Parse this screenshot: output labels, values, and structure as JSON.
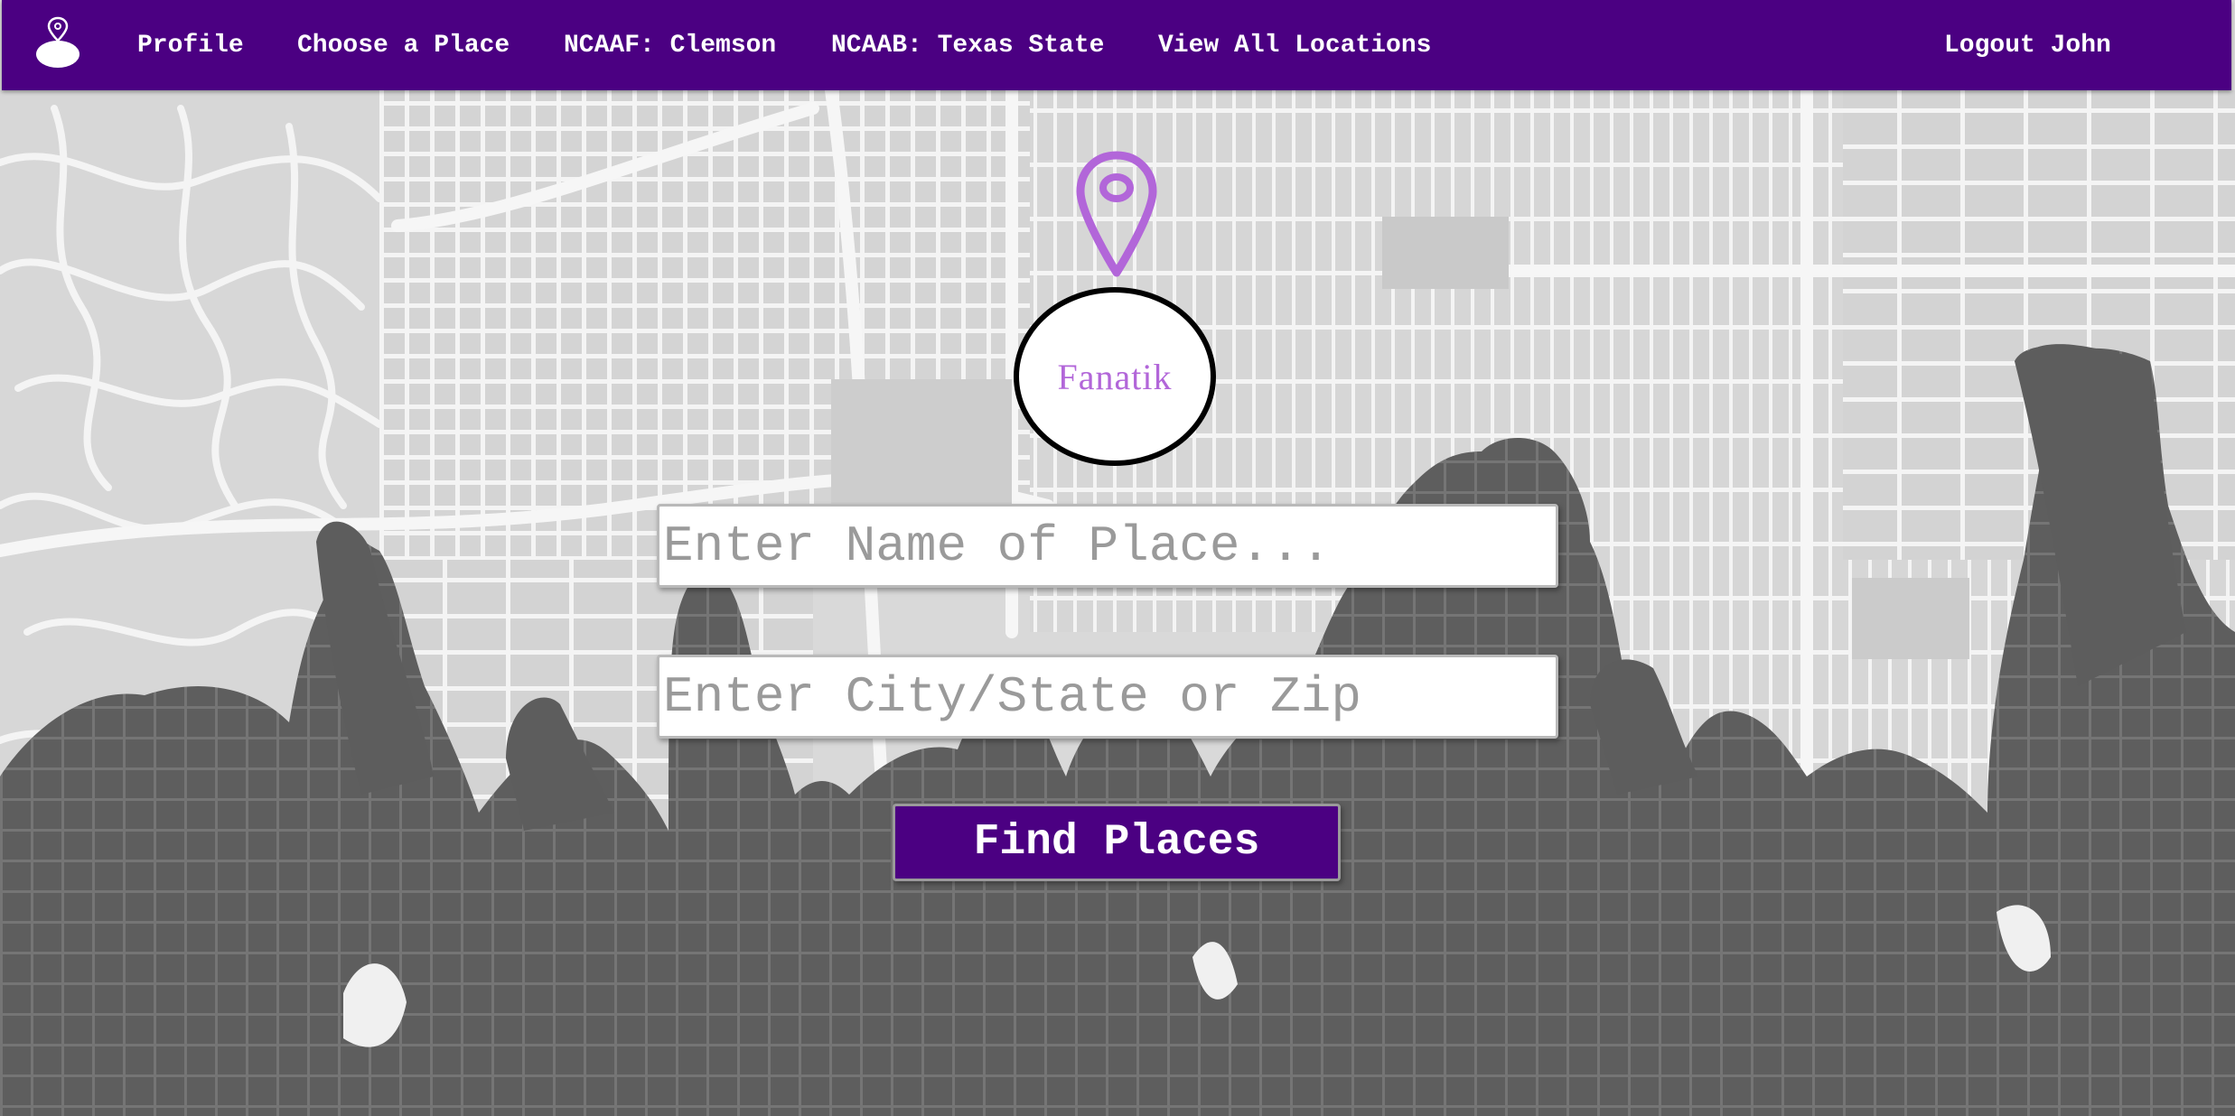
{
  "colors": {
    "brand_purple": "#4b0082",
    "accent_lavender": "#b266d9",
    "map_land": "#d9d9d9",
    "map_roads": "#f4f4f4",
    "crowd_silhouette": "#5f5f5f"
  },
  "navbar": {
    "logo_icon": "map-pin-icon",
    "links": {
      "profile": "Profile",
      "choose_place": "Choose a Place",
      "ncaaf": "NCAAF: Clemson",
      "ncaab": "NCAAB: Texas State",
      "view_all": "View All Locations",
      "logout": "Logout John"
    }
  },
  "brand": {
    "icon": "map-pin-icon",
    "name": "Fanatik"
  },
  "search": {
    "place_placeholder": "Enter Name of Place...",
    "place_value": "",
    "location_placeholder": "Enter City/State or Zip",
    "location_value": "",
    "submit_label": "Find Places"
  }
}
